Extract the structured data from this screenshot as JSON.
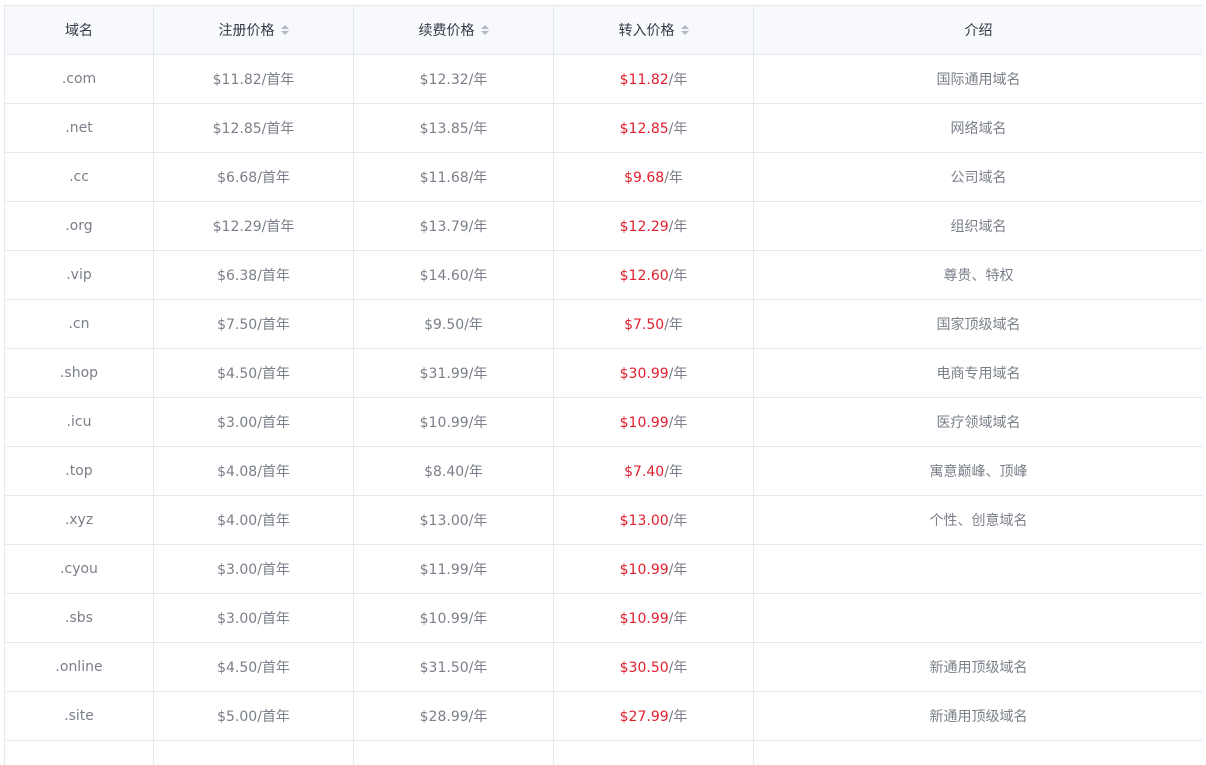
{
  "header": {
    "domain": "域名",
    "register": "注册价格",
    "renew": "续费价格",
    "transfer": "转入价格",
    "description": "介绍"
  },
  "colors": {
    "transfer_price": "#e0202e",
    "text": "#7a7f89",
    "header_bg": "#f8f9fc"
  },
  "rows": [
    {
      "domain": ".com",
      "register": "$11.82",
      "register_unit": "/首年",
      "renew": "$12.32",
      "renew_unit": "/年",
      "transfer": "$11.82",
      "transfer_unit": "/年",
      "description": "国际通用域名"
    },
    {
      "domain": ".net",
      "register": "$12.85",
      "register_unit": "/首年",
      "renew": "$13.85",
      "renew_unit": "/年",
      "transfer": "$12.85",
      "transfer_unit": "/年",
      "description": "网络域名"
    },
    {
      "domain": ".cc",
      "register": "$6.68",
      "register_unit": "/首年",
      "renew": "$11.68",
      "renew_unit": "/年",
      "transfer": "$9.68",
      "transfer_unit": "/年",
      "description": "公司域名"
    },
    {
      "domain": ".org",
      "register": "$12.29",
      "register_unit": "/首年",
      "renew": "$13.79",
      "renew_unit": "/年",
      "transfer": "$12.29",
      "transfer_unit": "/年",
      "description": "组织域名"
    },
    {
      "domain": ".vip",
      "register": "$6.38",
      "register_unit": "/首年",
      "renew": "$14.60",
      "renew_unit": "/年",
      "transfer": "$12.60",
      "transfer_unit": "/年",
      "description": "尊贵、特权"
    },
    {
      "domain": ".cn",
      "register": "$7.50",
      "register_unit": "/首年",
      "renew": "$9.50",
      "renew_unit": "/年",
      "transfer": "$7.50",
      "transfer_unit": "/年",
      "description": "国家顶级域名"
    },
    {
      "domain": ".shop",
      "register": "$4.50",
      "register_unit": "/首年",
      "renew": "$31.99",
      "renew_unit": "/年",
      "transfer": "$30.99",
      "transfer_unit": "/年",
      "description": "电商专用域名"
    },
    {
      "domain": ".icu",
      "register": "$3.00",
      "register_unit": "/首年",
      "renew": "$10.99",
      "renew_unit": "/年",
      "transfer": "$10.99",
      "transfer_unit": "/年",
      "description": "医疗领域域名"
    },
    {
      "domain": ".top",
      "register": "$4.08",
      "register_unit": "/首年",
      "renew": "$8.40",
      "renew_unit": "/年",
      "transfer": "$7.40",
      "transfer_unit": "/年",
      "description": "寓意巅峰、顶峰"
    },
    {
      "domain": ".xyz",
      "register": "$4.00",
      "register_unit": "/首年",
      "renew": "$13.00",
      "renew_unit": "/年",
      "transfer": "$13.00",
      "transfer_unit": "/年",
      "description": "个性、创意域名"
    },
    {
      "domain": ".cyou",
      "register": "$3.00",
      "register_unit": "/首年",
      "renew": "$11.99",
      "renew_unit": "/年",
      "transfer": "$10.99",
      "transfer_unit": "/年",
      "description": ""
    },
    {
      "domain": ".sbs",
      "register": "$3.00",
      "register_unit": "/首年",
      "renew": "$10.99",
      "renew_unit": "/年",
      "transfer": "$10.99",
      "transfer_unit": "/年",
      "description": ""
    },
    {
      "domain": ".online",
      "register": "$4.50",
      "register_unit": "/首年",
      "renew": "$31.50",
      "renew_unit": "/年",
      "transfer": "$30.50",
      "transfer_unit": "/年",
      "description": "新通用顶级域名"
    },
    {
      "domain": ".site",
      "register": "$5.00",
      "register_unit": "/首年",
      "renew": "$28.99",
      "renew_unit": "/年",
      "transfer": "$27.99",
      "transfer_unit": "/年",
      "description": "新通用顶级域名"
    },
    {
      "domain": "",
      "register": "",
      "register_unit": "",
      "renew": "",
      "renew_unit": "",
      "transfer": "",
      "transfer_unit": "",
      "description": ""
    }
  ]
}
